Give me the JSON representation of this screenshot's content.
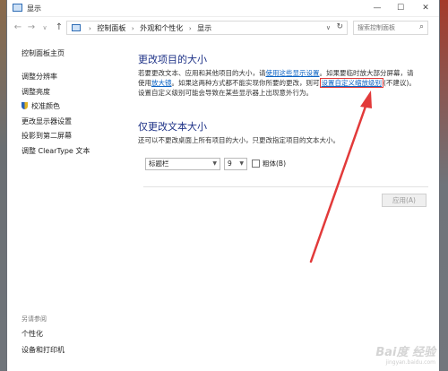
{
  "window": {
    "title": "显示"
  },
  "window_buttons": {
    "minimize": "—",
    "maximize": "☐",
    "close": "✕"
  },
  "nav": {
    "back": "←",
    "forward": "→",
    "recent": "∨",
    "up": "↑"
  },
  "breadcrumb": [
    "控制面板",
    "外观和个性化",
    "显示"
  ],
  "search": {
    "placeholder": "搜索控制面板"
  },
  "sidebar": {
    "home": "控制面板主页",
    "items": [
      "调整分辨率",
      "调整亮度",
      "校准颜色",
      "更改显示器设置",
      "投影到第二屏幕",
      "调整 ClearType 文本"
    ],
    "see_also_label": "另请参阅",
    "see_also": [
      "个性化",
      "设备和打印机"
    ]
  },
  "main": {
    "heading1": "更改项目的大小",
    "para1_a": "若要更改文本、应用和其他项目的大小，请",
    "para1_link1": "使用这些显示设置",
    "para1_b": "。如果要临时放大部分屏幕，请",
    "para2_a": "使用",
    "para2_link2": "放大镜",
    "para2_b": "。如果这两种方式都不能实现你所要的更改，则可",
    "para2_link3": "设置自定义缩放级别",
    "para2_c": "(不建议)。",
    "para3": "设置自定义级别可能会导致在某些显示器上出现意外行为。",
    "heading2": "仅更改文本大小",
    "para4": "还可以不更改桌面上所有项目的大小，只更改指定项目的文本大小。",
    "item_select": "标题栏",
    "size_select": "9",
    "bold_label": "粗体(B)",
    "apply_button": "应用(A)"
  },
  "watermark": {
    "main": "Bai度 经验",
    "sub": "jingyan.baidu.com"
  },
  "colors": {
    "heading": "#1e3287",
    "link": "#0b63c4",
    "annotation": "#e23a3a"
  }
}
